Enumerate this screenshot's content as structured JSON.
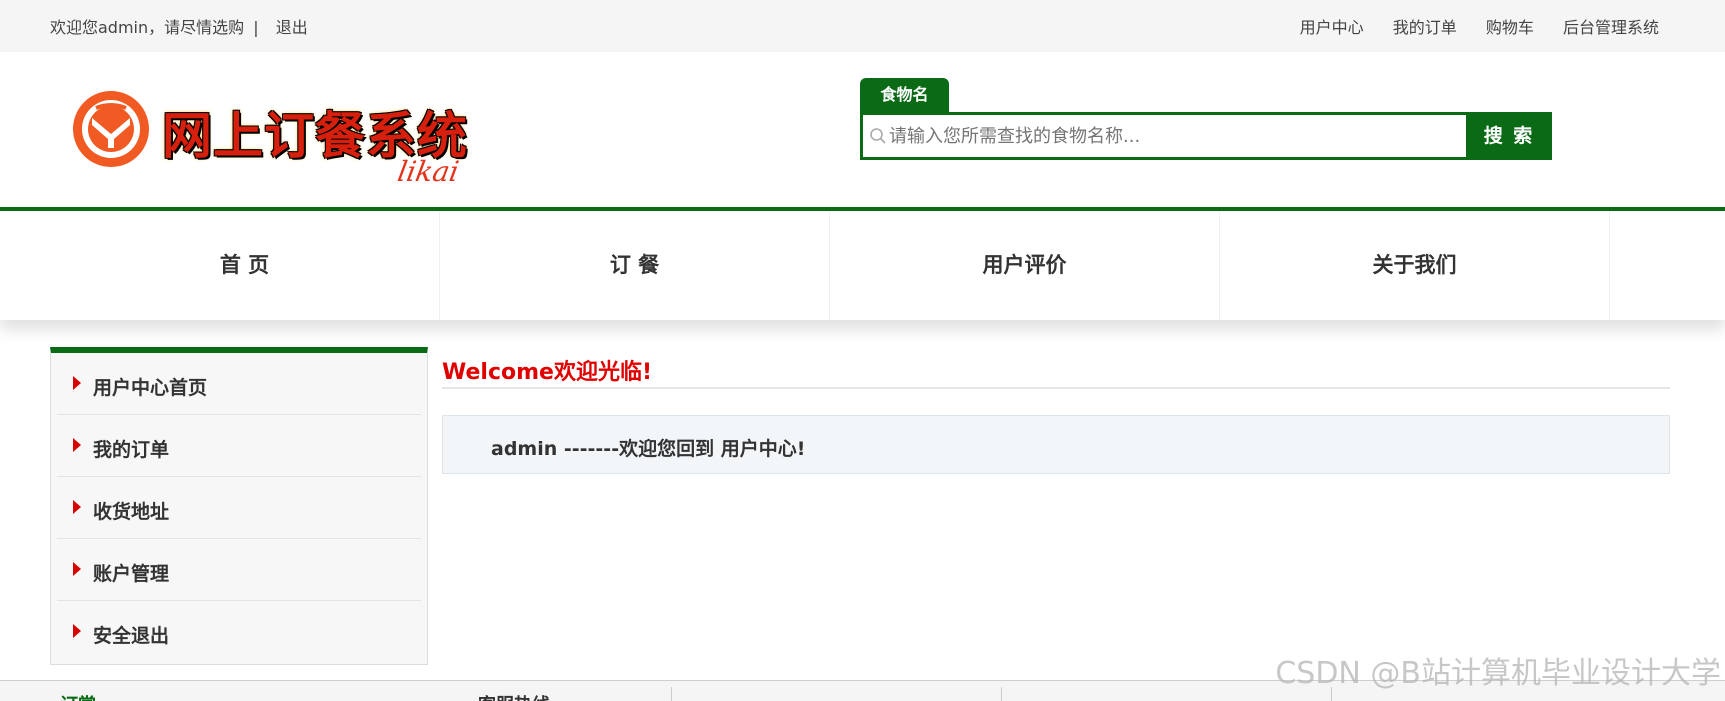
{
  "topbar": {
    "welcome": "欢迎您admin，请尽情选购",
    "separator": "|",
    "logout": "退出",
    "links": [
      "用户中心",
      "我的订单",
      "购物车",
      "后台管理系统"
    ]
  },
  "logo": {
    "title": "网上订餐系统",
    "subtitle": "likai"
  },
  "search": {
    "tab_label": "食物名",
    "placeholder": "请输入您所需查找的食物名称...",
    "button_label": "搜 索"
  },
  "nav": {
    "items": [
      "首 页",
      "订 餐",
      "用户评价",
      "关于我们"
    ]
  },
  "sidebar": {
    "items": [
      "用户中心首页",
      "我的订单",
      "收货地址",
      "账户管理",
      "安全退出"
    ]
  },
  "main": {
    "title": "Welcome欢迎光临!",
    "message": "admin -------欢迎您回到 用户中心!"
  },
  "footer": {
    "col1": "订赏:",
    "col2": "客服热线"
  },
  "watermark": "CSDN @B站计算机毕业设计大学",
  "colors": {
    "brand_green": "#0b6a16",
    "accent_red": "#e00000"
  }
}
